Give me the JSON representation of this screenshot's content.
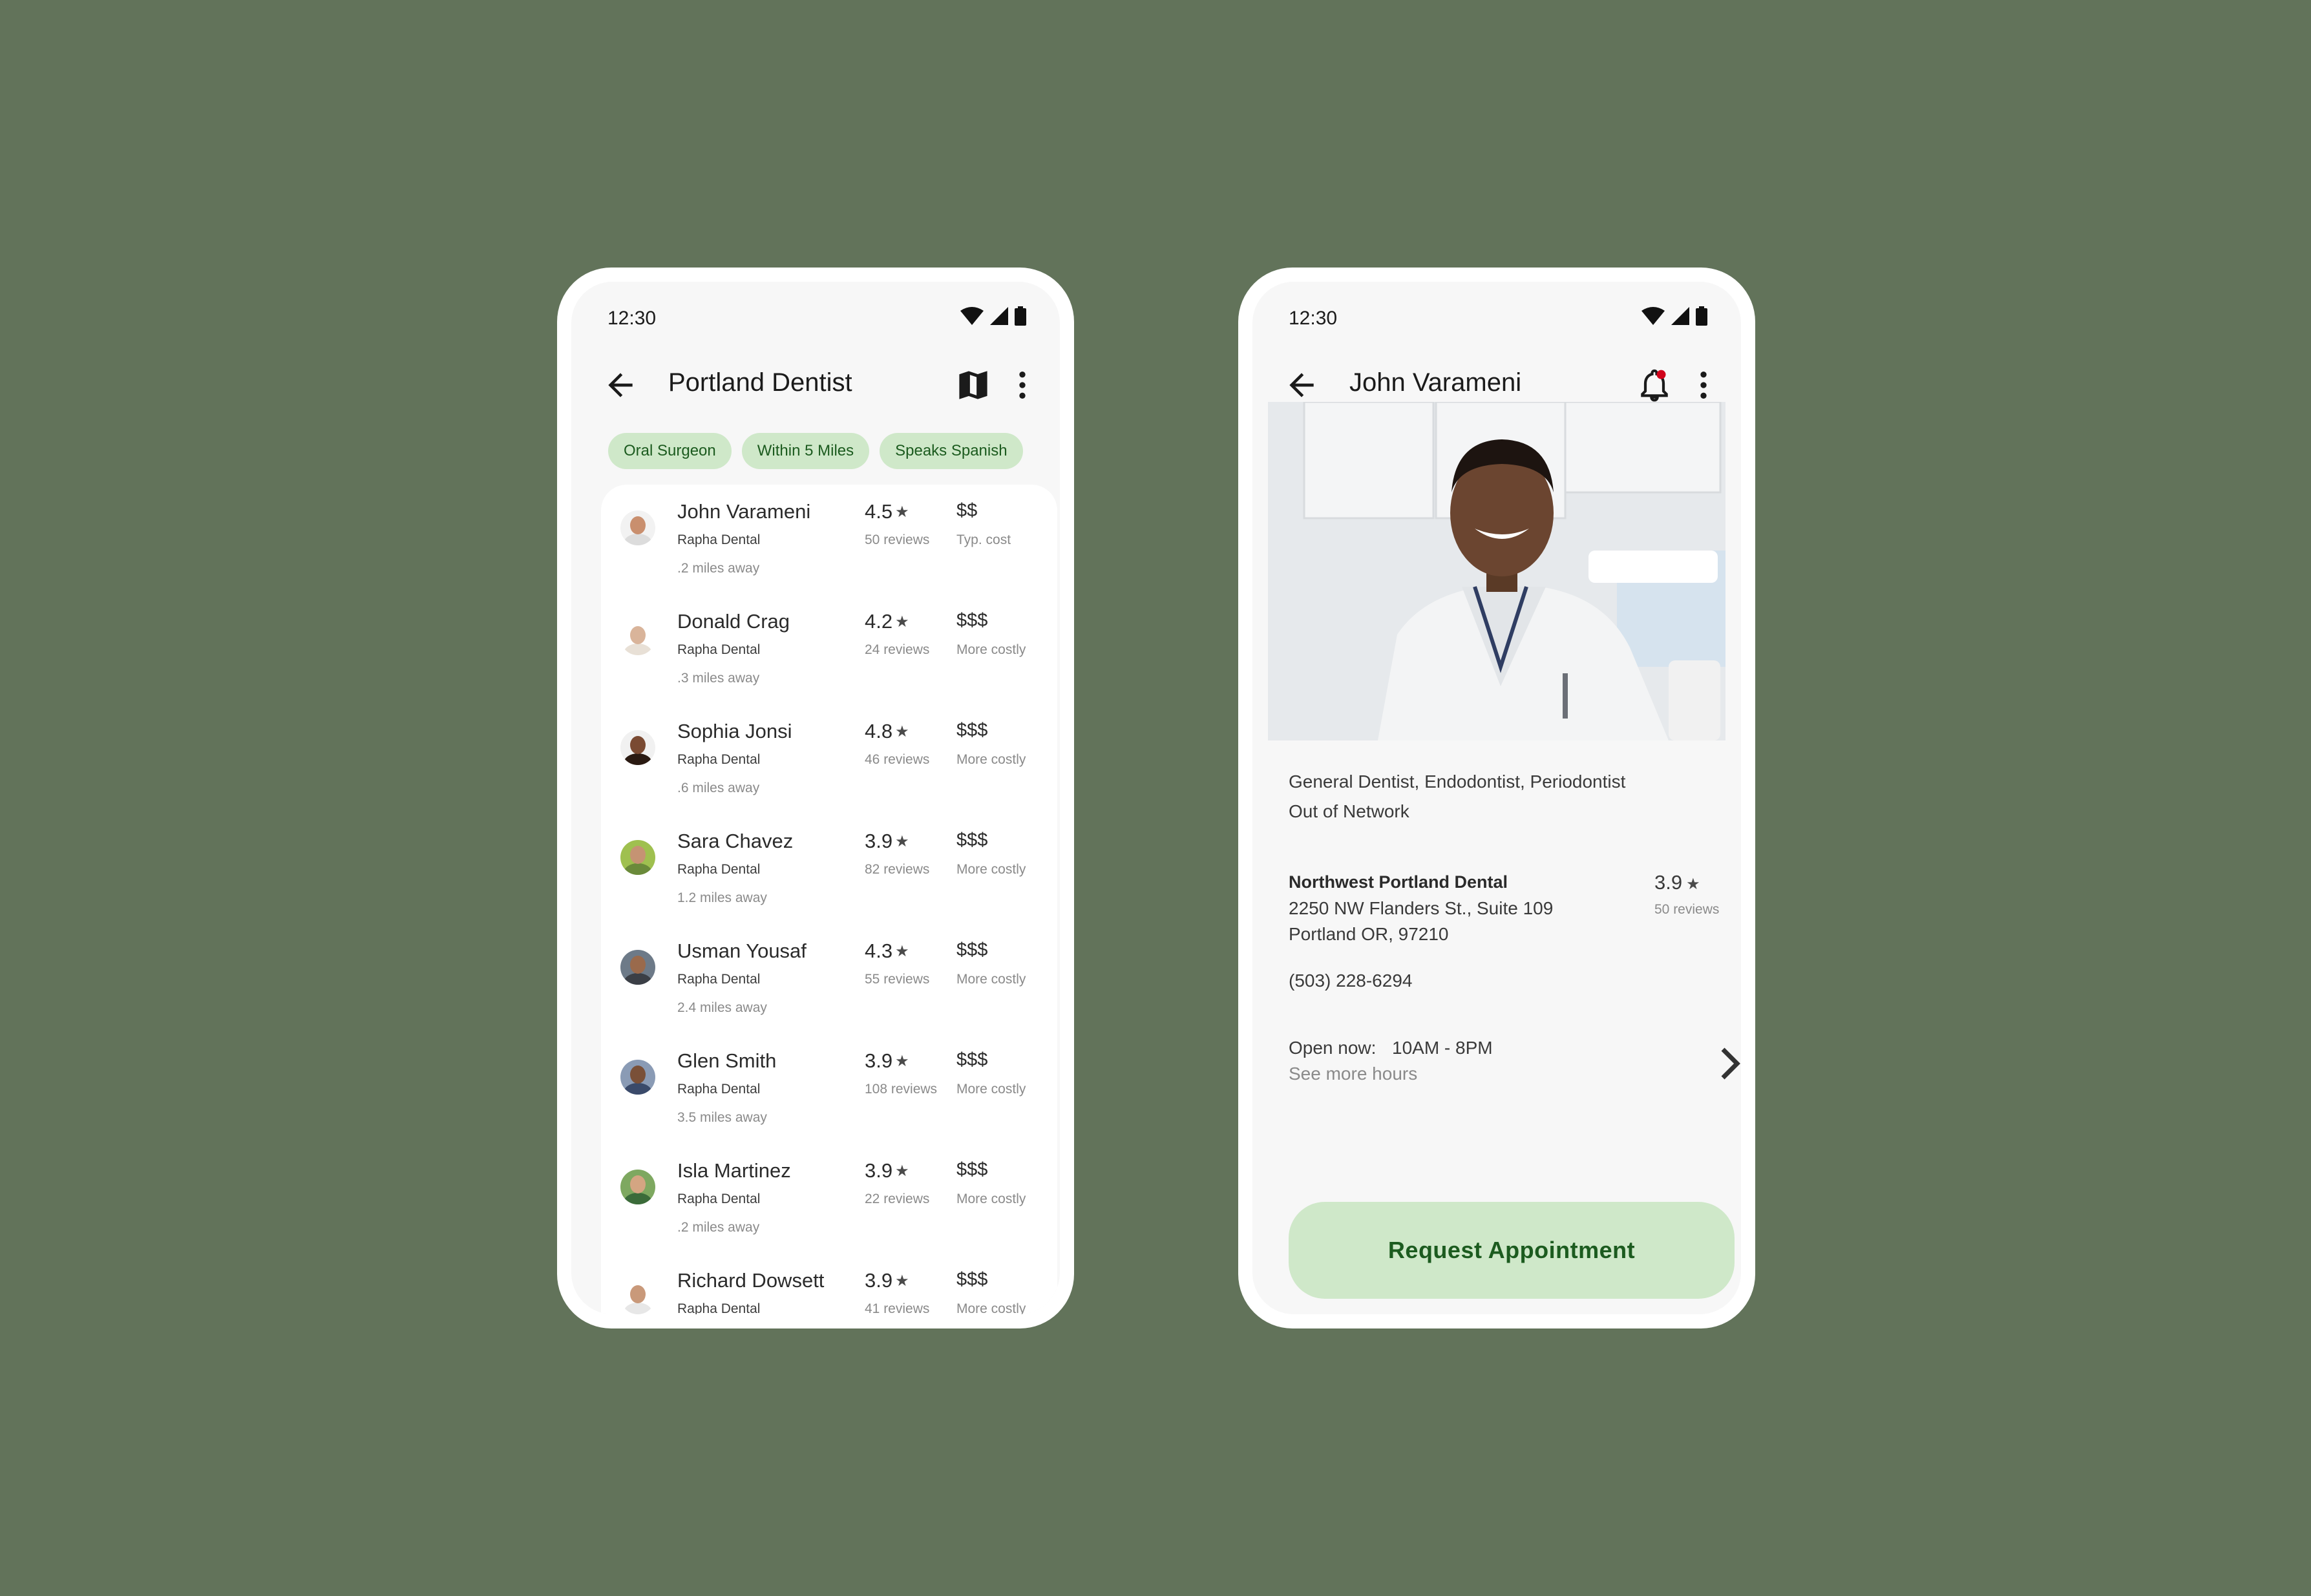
{
  "colors": {
    "background": "#62735a",
    "chip_bg": "#cfe8c9",
    "chip_text": "#1c5b1f",
    "notification_dot": "#d0021b"
  },
  "list_screen": {
    "status": {
      "time": "12:30",
      "icons": [
        "wifi-icon",
        "signal-icon",
        "battery-icon"
      ]
    },
    "appbar": {
      "title": "Portland Dentist",
      "back_icon": "arrow-back-icon",
      "actions": [
        "map-icon",
        "more-vert-icon"
      ]
    },
    "chips": [
      "Oral Surgeon",
      "Within 5 Miles",
      "Speaks Spanish"
    ],
    "dentists": [
      {
        "name": "John Varameni",
        "clinic": "Rapha Dental",
        "distance": ".2 miles away",
        "rating": "4.5",
        "reviews": "50 reviews",
        "cost": "$$",
        "cost_note": "Typ. cost"
      },
      {
        "name": "Donald Crag",
        "clinic": "Rapha Dental",
        "distance": ".3 miles away",
        "rating": "4.2",
        "reviews": "24 reviews",
        "cost": "$$$",
        "cost_note": "More costly"
      },
      {
        "name": "Sophia Jonsi",
        "clinic": "Rapha Dental",
        "distance": ".6 miles away",
        "rating": "4.8",
        "reviews": "46 reviews",
        "cost": "$$$",
        "cost_note": "More costly"
      },
      {
        "name": "Sara Chavez",
        "clinic": "Rapha Dental",
        "distance": "1.2 miles away",
        "rating": "3.9",
        "reviews": "82 reviews",
        "cost": "$$$",
        "cost_note": "More costly"
      },
      {
        "name": "Usman Yousaf",
        "clinic": "Rapha Dental",
        "distance": "2.4 miles away",
        "rating": "4.3",
        "reviews": "55 reviews",
        "cost": "$$$",
        "cost_note": "More costly"
      },
      {
        "name": "Glen Smith",
        "clinic": "Rapha Dental",
        "distance": "3.5 miles away",
        "rating": "3.9",
        "reviews": "108 reviews",
        "cost": "$$$",
        "cost_note": "More costly"
      },
      {
        "name": "Isla Martinez",
        "clinic": "Rapha Dental",
        "distance": ".2 miles away",
        "rating": "3.9",
        "reviews": "22 reviews",
        "cost": "$$$",
        "cost_note": "More costly"
      },
      {
        "name": "Richard Dowsett",
        "clinic": "Rapha Dental",
        "distance": "",
        "rating": "3.9",
        "reviews": "41 reviews",
        "cost": "$$$",
        "cost_note": "More costly"
      }
    ]
  },
  "detail_screen": {
    "status": {
      "time": "12:30"
    },
    "appbar": {
      "title": "John Varameni",
      "actions": [
        "notification-bell-icon",
        "more-vert-icon"
      ]
    },
    "specialties": "General Dentist, Endodontist, Periodontist",
    "network": "Out of Network",
    "office": {
      "name": "Northwest Portland Dental",
      "address_line1": "2250 NW Flanders St., Suite 109",
      "address_line2": "Portland OR, 97210",
      "rating": "3.9",
      "reviews": "50 reviews"
    },
    "phone": "(503) 228-6294",
    "hours": {
      "label": "Open now:",
      "value": "10AM - 8PM",
      "more": "See more hours"
    },
    "cta_label": "Request Appointment"
  }
}
